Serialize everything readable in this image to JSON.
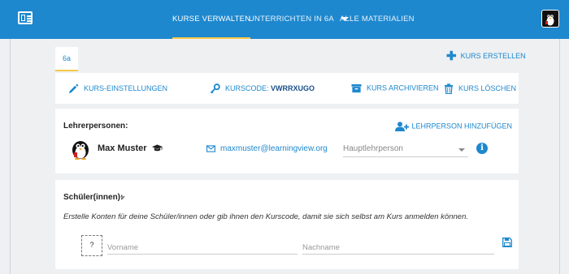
{
  "topbar": {
    "nav": [
      {
        "label": "KURSE VERWALTEN"
      },
      {
        "label": "UNTERRICHTEN IN 6A"
      },
      {
        "label": "ALLE MATERIALIEN"
      }
    ]
  },
  "course": {
    "tab_label": "6a",
    "create_label": "KURS ERSTELLEN"
  },
  "actions": {
    "settings": "KURS-EINSTELLUNGEN",
    "code_label": "KURSCODE:",
    "code_value": "VWRRXUGO",
    "archive": "KURS ARCHIVIEREN",
    "delete": "KURS LÖSCHEN"
  },
  "teachers": {
    "title": "Lehrerpersonen:",
    "add_label": "LEHRPERSON HINZUFÜGEN",
    "items": [
      {
        "name": "Max Muster",
        "email": "maxmuster@learningview.org",
        "role_placeholder": "Hauptlehrperson"
      }
    ]
  },
  "students": {
    "title": "Schüler(innen):",
    "description": "Erstelle Konten für deine Schüler/innen oder gib ihnen den Kurscode, damit sie sich selbst am Kurs anmelden können.",
    "photo_placeholder": "?",
    "firstname_placeholder": "Vorname",
    "lastname_placeholder": "Nachname"
  },
  "colors": {
    "primary": "#1e88cf",
    "accent": "#f7c948",
    "background": "#eef0f2"
  }
}
